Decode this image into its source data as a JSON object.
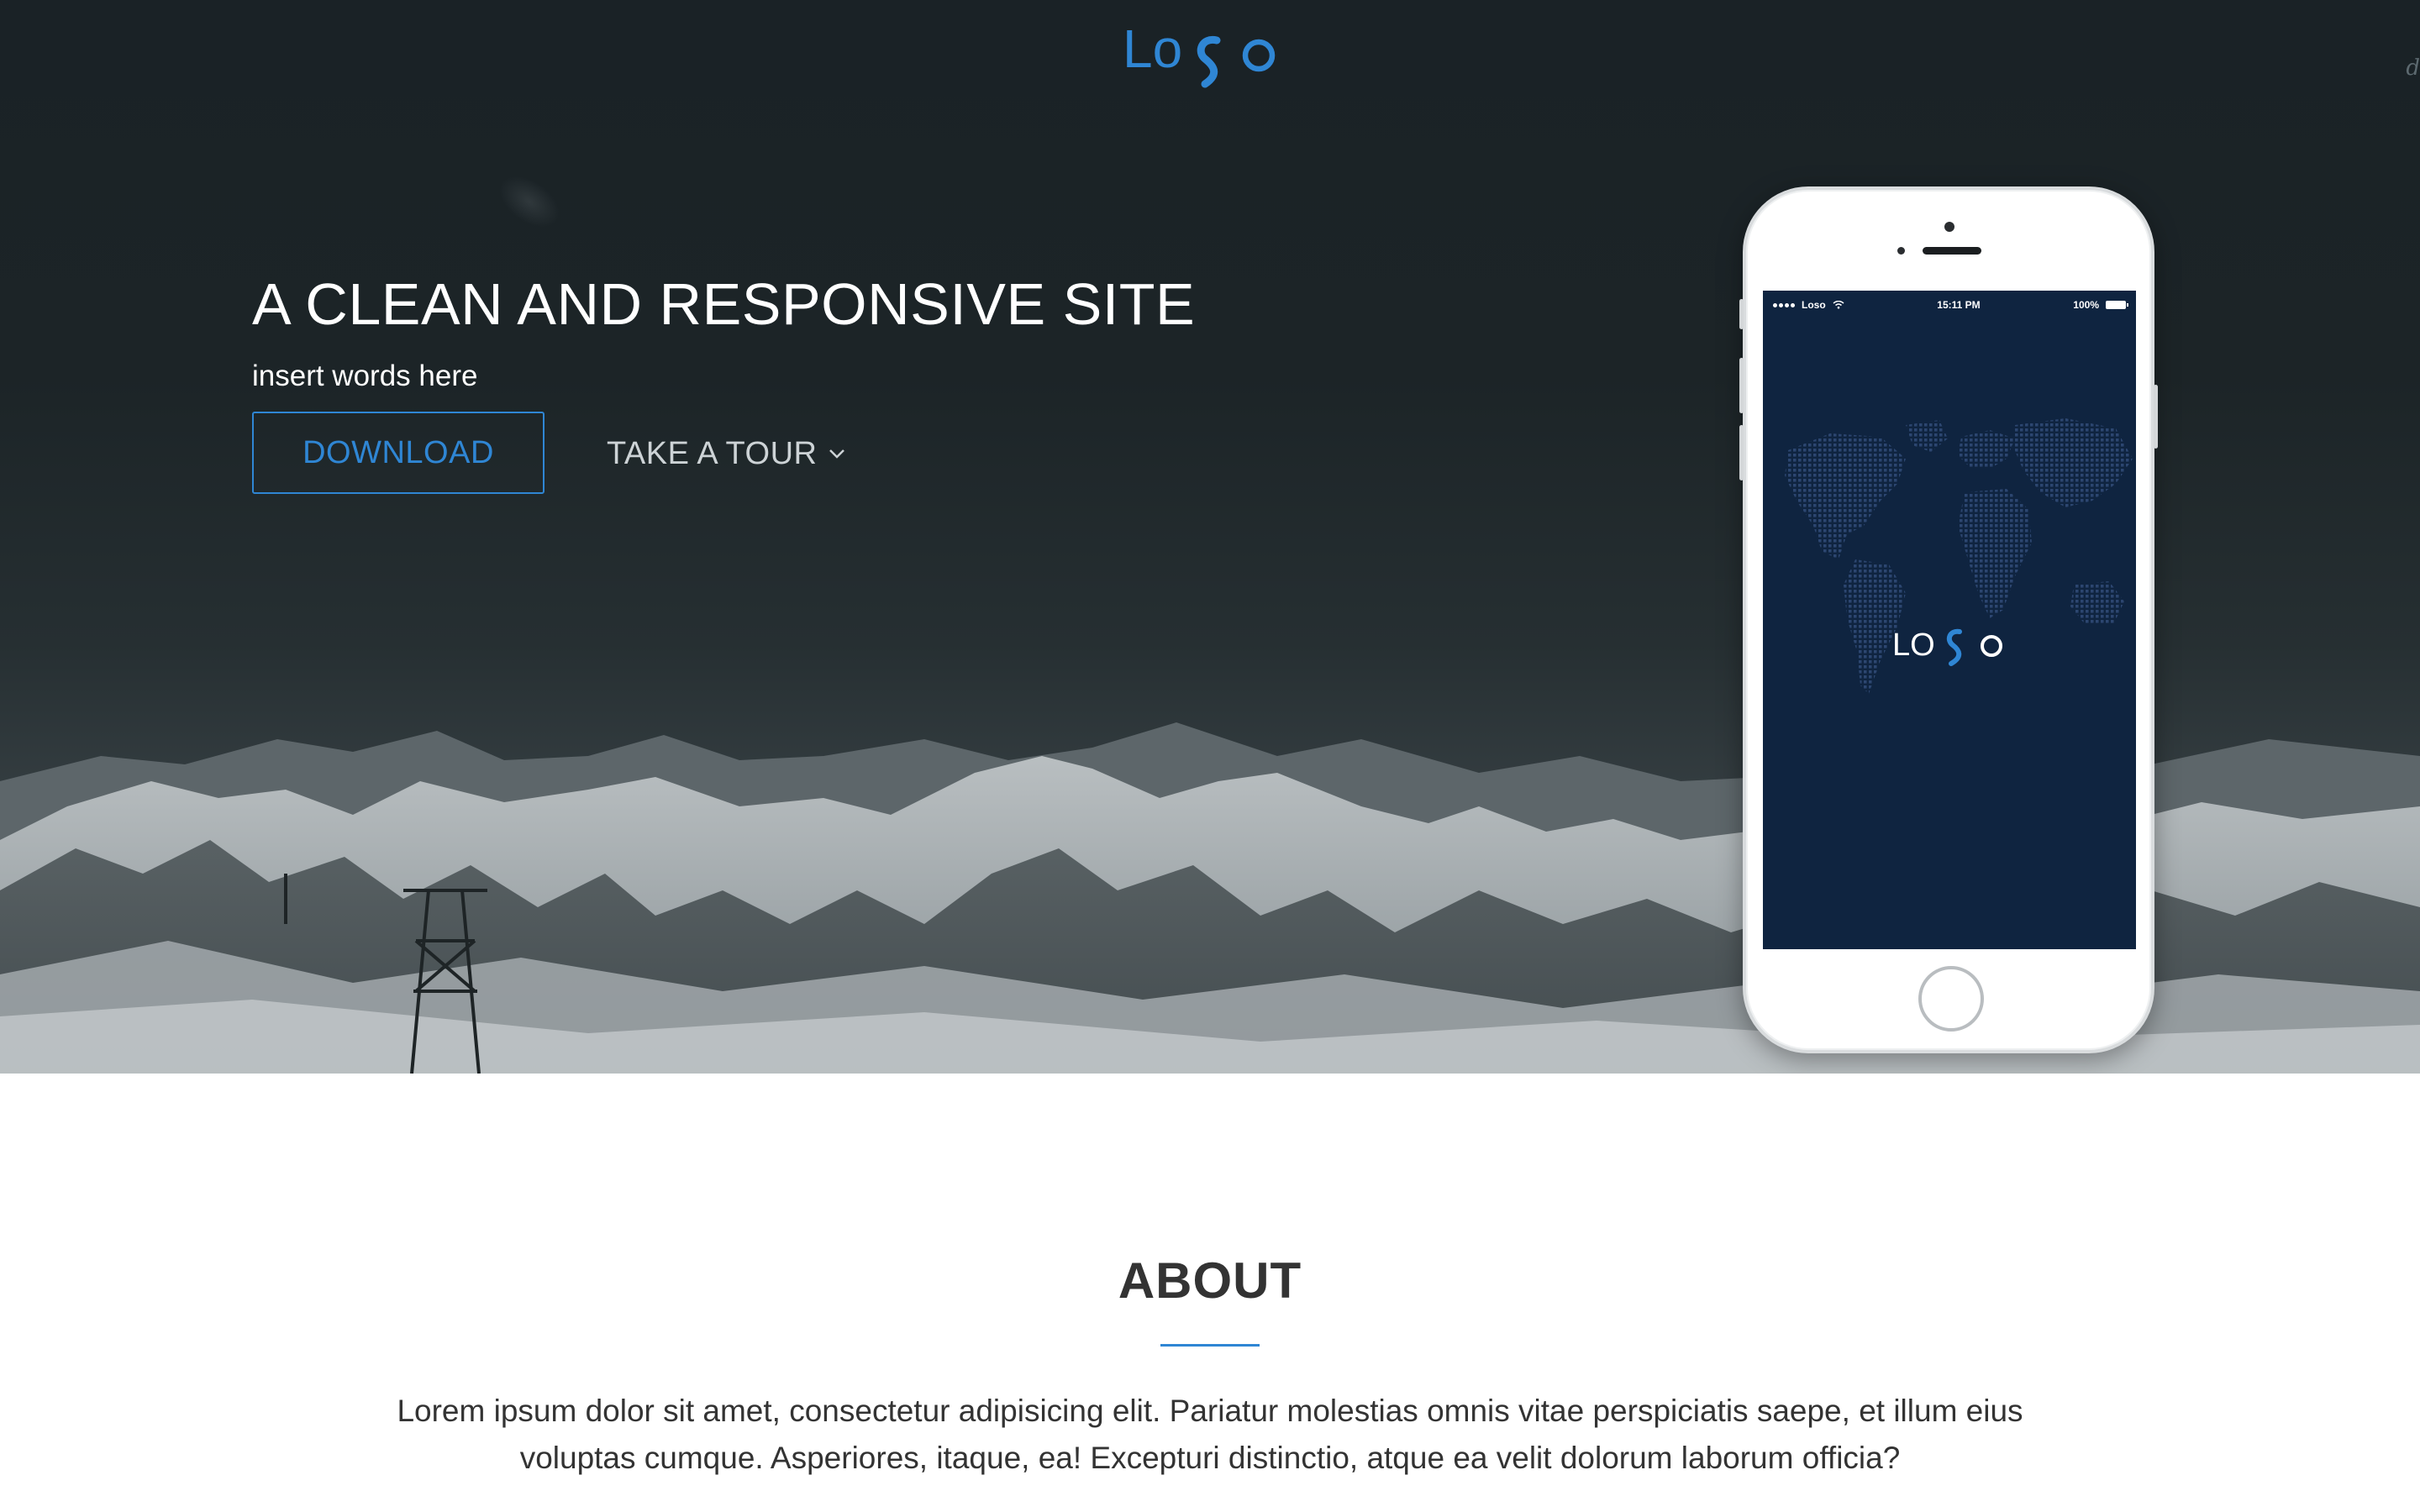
{
  "brand": {
    "logo_alt": "LoSo",
    "accent_color": "#2f86d4"
  },
  "hero": {
    "corner_mark": "d",
    "title": "A CLEAN AND RESPONSIVE SITE",
    "subtitle": "insert words here",
    "download_label": "DOWNLOAD",
    "tour_label": "TAKE A TOUR",
    "tour_icon": "chevron-down-icon"
  },
  "phone": {
    "status": {
      "carrier": "Loso",
      "time": "15:11 PM",
      "battery": "100%"
    },
    "app_logo_alt": "LOSO",
    "screen_color": "#0f2440"
  },
  "about": {
    "title": "ABOUT",
    "text": "Lorem ipsum dolor sit amet, consectetur adipisicing elit. Pariatur molestias omnis vitae perspiciatis saepe, et illum eius voluptas cumque. Asperiores, itaque, ea! Excepturi distinctio, atque ea velit dolorum laborum officia?"
  }
}
